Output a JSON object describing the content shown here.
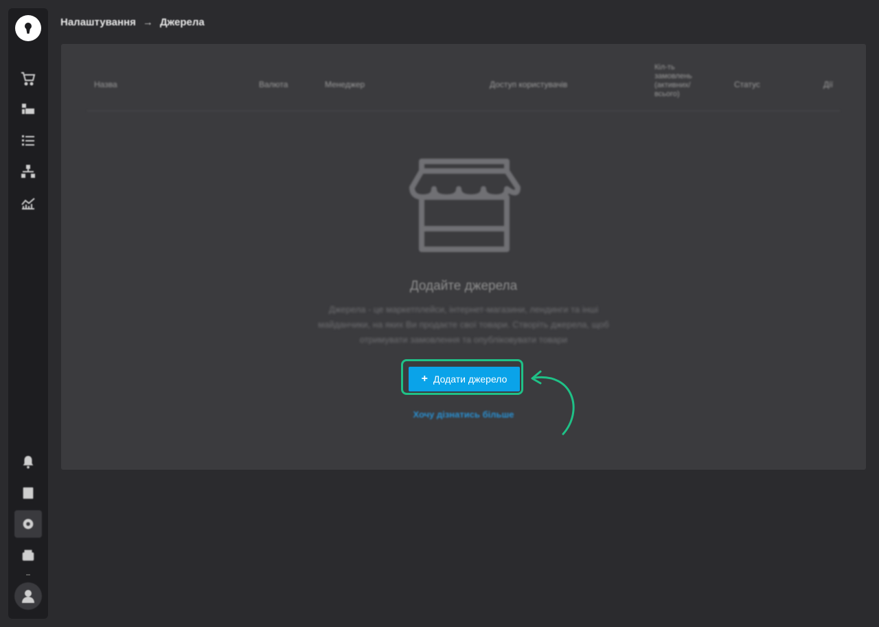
{
  "sidebar": {
    "logo_icon": "keyhole-logo-icon",
    "top_items": [
      {
        "name": "cart-icon"
      },
      {
        "name": "products-icon"
      },
      {
        "name": "list-icon"
      },
      {
        "name": "structure-icon"
      },
      {
        "name": "analytics-icon"
      }
    ],
    "bottom_items": [
      {
        "name": "bell-icon"
      },
      {
        "name": "book-icon"
      },
      {
        "name": "gear-icon",
        "active": true
      },
      {
        "name": "wallet-icon"
      }
    ],
    "avatar_icon": "user-avatar-icon"
  },
  "breadcrumb": {
    "parent": "Налаштування",
    "separator": "→",
    "current": "Джерела"
  },
  "table": {
    "columns": [
      "Назва",
      "Валюта",
      "Менеджер",
      "Доступ користувачів",
      "Кіл-ть замовлень (активних/ всього)",
      "Статус",
      "Дії"
    ]
  },
  "empty_state": {
    "icon": "storefront-icon",
    "title": "Додайте джерела",
    "description": "Джерела - це маркетплейси, інтернет-магазини, лендинги та інші майданчики, на яких Ви продаєте свої товари. Створіть джерела, щоб отримувати замовлення та опубліковувати товари",
    "add_button": "Додати джерело",
    "learn_more": "Хочу дізнатись більше"
  },
  "colors": {
    "background": "#2b2b2e",
    "sidebar": "#1d1d20",
    "panel": "#3b3b3e",
    "primary_button": "#0aa3e9",
    "highlight": "#1fc187",
    "link": "#2a8fd0"
  }
}
